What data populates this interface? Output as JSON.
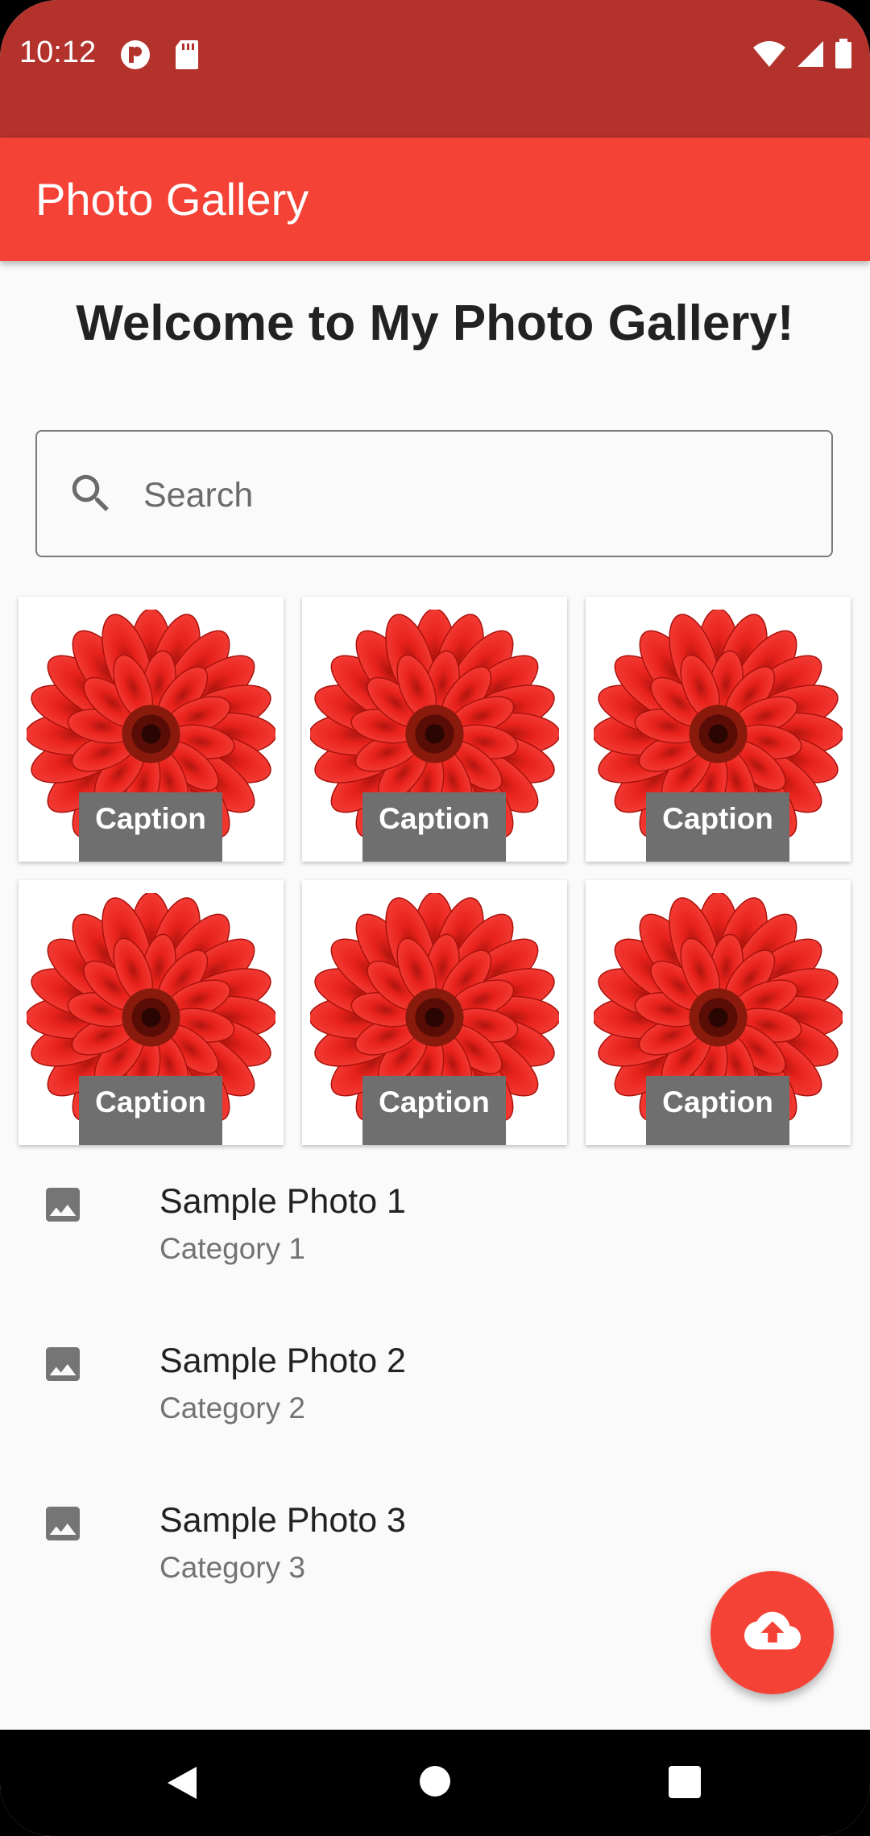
{
  "status_bar": {
    "time": "10:12",
    "icons_left": [
      "app-notification-icon",
      "sd-card-icon"
    ],
    "icons_right": [
      "wifi-icon",
      "signal-icon",
      "battery-icon"
    ]
  },
  "app_bar": {
    "title": "Photo Gallery",
    "color": "#f44336"
  },
  "welcome": "Welcome to My Photo Gallery!",
  "search": {
    "placeholder": "Search",
    "value": ""
  },
  "gallery": {
    "tiles": [
      {
        "caption": "Caption",
        "image": "red-gerbera-flower"
      },
      {
        "caption": "Caption",
        "image": "red-gerbera-flower"
      },
      {
        "caption": "Caption",
        "image": "red-gerbera-flower"
      },
      {
        "caption": "Caption",
        "image": "red-gerbera-flower"
      },
      {
        "caption": "Caption",
        "image": "red-gerbera-flower"
      },
      {
        "caption": "Caption",
        "image": "red-gerbera-flower"
      }
    ]
  },
  "list": [
    {
      "title": "Sample Photo 1",
      "subtitle": "Category 1",
      "icon": "image-icon"
    },
    {
      "title": "Sample Photo 2",
      "subtitle": "Category 2",
      "icon": "image-icon"
    },
    {
      "title": "Sample Photo 3",
      "subtitle": "Category 3",
      "icon": "image-icon"
    }
  ],
  "fab": {
    "icon": "cloud-upload-icon"
  },
  "nav_bar": {
    "buttons": [
      "back-icon",
      "home-icon",
      "recents-icon"
    ]
  },
  "colors": {
    "status_bar": "#b3322b",
    "primary": "#f44336",
    "background": "#fafafa"
  }
}
